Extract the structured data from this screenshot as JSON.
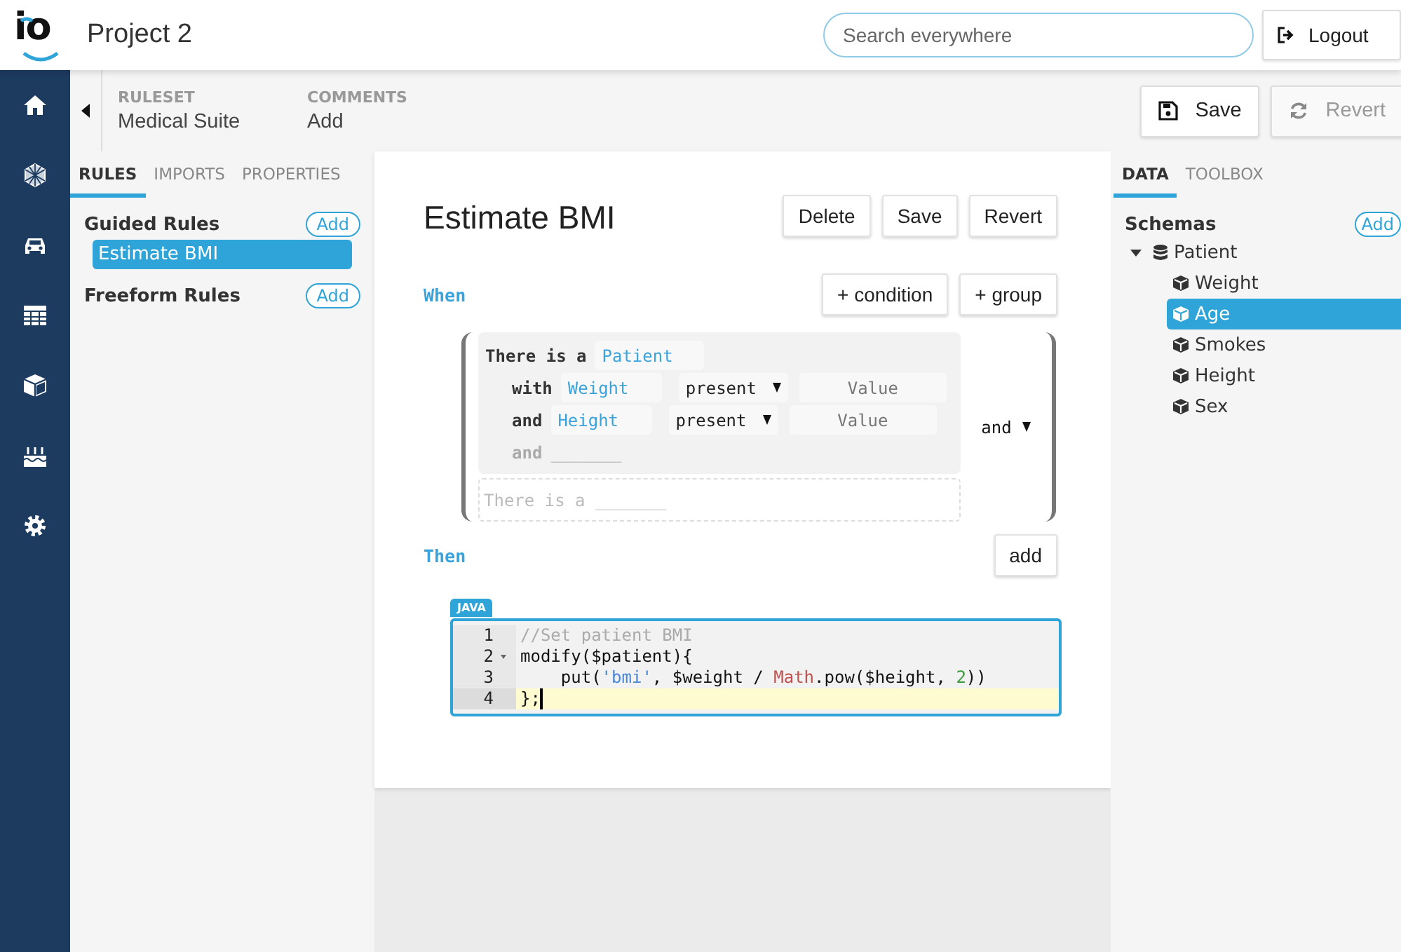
{
  "header": {
    "logo": "io",
    "title": "Project 2",
    "search": {
      "placeholder": "Search everywhere"
    },
    "logout": {
      "label": "Logout"
    }
  },
  "toolbar": {
    "fields": [
      {
        "label": "RULESET",
        "value": "Medical Suite"
      },
      {
        "label": "COMMENTS",
        "value": "Add"
      }
    ],
    "buttons": [
      {
        "kind": "save",
        "label": "Save",
        "disabled": false
      },
      {
        "kind": "revert",
        "label": "Revert",
        "disabled": true
      }
    ]
  },
  "rules_panel": {
    "tabs": [
      {
        "label": "RULES",
        "selected": true
      },
      {
        "label": "IMPORTS",
        "selected": false
      },
      {
        "label": "PROPERTIES",
        "selected": false
      }
    ],
    "sections": [
      {
        "title": "Guided Rules",
        "add": "Add",
        "items": [
          {
            "label": "Estimate BMI",
            "selected": true
          }
        ]
      },
      {
        "title": "Freeform Rules",
        "add": "Add"
      }
    ]
  },
  "editor": {
    "title": "Estimate BMI",
    "buttons": [
      "Delete",
      "Save",
      "Revert"
    ],
    "when": {
      "label": "When",
      "buttons": [
        "+ condition",
        "+ group"
      ],
      "operator": "and",
      "pattern": {
        "prefix": "There is a",
        "type": "Patient",
        "constraints": [
          {
            "connector": "with",
            "field": "Weight",
            "operator": "present",
            "value_placeholder": "Value"
          },
          {
            "connector": "and",
            "field": "Height",
            "operator": "present",
            "value_placeholder": "Value"
          }
        ],
        "new_constraint": {
          "connector": "and",
          "blank": "_______"
        }
      },
      "new_pattern": {
        "prefix": "There is a",
        "blank": "_______"
      }
    },
    "then": {
      "label": "Then",
      "button": "add",
      "language": "JAVA",
      "lines": [
        {
          "number": "1",
          "foldable": false,
          "active": false,
          "cursor": false,
          "tokens": [
            {
              "kind": "comment",
              "text": "//Set patient BMI"
            }
          ]
        },
        {
          "number": "2",
          "foldable": true,
          "active": false,
          "cursor": false,
          "tokens": [
            {
              "kind": "plain",
              "text": "modify($patient){"
            }
          ]
        },
        {
          "number": "3",
          "foldable": false,
          "active": false,
          "cursor": false,
          "tokens": [
            {
              "kind": "plain",
              "text": "    put("
            },
            {
              "kind": "string",
              "text": "'bmi'"
            },
            {
              "kind": "plain",
              "text": ", $weight / "
            },
            {
              "kind": "builtin",
              "text": "Math"
            },
            {
              "kind": "plain",
              "text": ".pow($height, "
            },
            {
              "kind": "number",
              "text": "2"
            },
            {
              "kind": "plain",
              "text": "))"
            }
          ]
        },
        {
          "number": "4",
          "foldable": false,
          "active": true,
          "cursor": true,
          "tokens": [
            {
              "kind": "plain",
              "text": "};"
            }
          ]
        }
      ]
    }
  },
  "data_panel": {
    "tabs": [
      {
        "label": "DATA",
        "selected": true
      },
      {
        "label": "TOOLBOX",
        "selected": false
      }
    ],
    "title": "Schemas",
    "add": "Add",
    "tree": [
      {
        "label": "Patient",
        "expanded": true,
        "selected": false,
        "children": [
          {
            "label": "Weight",
            "selected": false
          },
          {
            "label": "Age",
            "selected": true
          },
          {
            "label": "Smokes",
            "selected": false
          },
          {
            "label": "Height",
            "selected": false
          },
          {
            "label": "Sex",
            "selected": false
          }
        ]
      }
    ]
  }
}
